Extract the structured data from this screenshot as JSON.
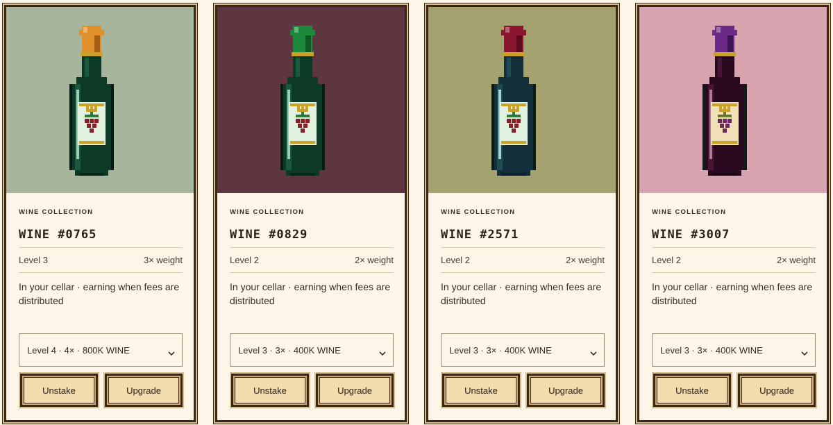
{
  "cards": [
    {
      "collection": "WINE COLLECTION",
      "name": "WINE #0765",
      "level": "Level 3",
      "weight": "3× weight",
      "status": "In your cellar · earning when fees are distributed",
      "upgrade_option": "Level 4 · 4× · 800K WINE",
      "unstake_label": "Unstake",
      "upgrade_label": "Upgrade",
      "art": {
        "bg": "#a6b59c",
        "cap": "#e0902a",
        "cap_dark": "#a35f14",
        "glass": "#0d3a26",
        "glass_mid": "#1a5a3a",
        "glass_hi": "#9ad0b4",
        "label": "#e2f2e0",
        "grape": "#8a1e26",
        "leaf": "#2e7a36"
      }
    },
    {
      "collection": "WINE COLLECTION",
      "name": "WINE #0829",
      "level": "Level 2",
      "weight": "2× weight",
      "status": "In your cellar · earning when fees are distributed",
      "upgrade_option": "Level 3 · 3× · 400K WINE",
      "unstake_label": "Unstake",
      "upgrade_label": "Upgrade",
      "art": {
        "bg": "#5e3640",
        "cap": "#1c8a3a",
        "cap_dark": "#0f5a24",
        "glass": "#0d3a26",
        "glass_mid": "#1a5a3a",
        "glass_hi": "#9ad0b4",
        "label": "#e2f2e0",
        "grape": "#8a1e26",
        "leaf": "#2e7a36"
      }
    },
    {
      "collection": "WINE COLLECTION",
      "name": "WINE #2571",
      "level": "Level 2",
      "weight": "2× weight",
      "status": "In your cellar · earning when fees are distributed",
      "upgrade_option": "Level 3 · 3× · 400K WINE",
      "unstake_label": "Unstake",
      "upgrade_label": "Upgrade",
      "art": {
        "bg": "#a4a26e",
        "cap": "#8a1630",
        "cap_dark": "#5a0c1e",
        "glass": "#13303a",
        "glass_mid": "#1e4a56",
        "glass_hi": "#a8d4dc",
        "label": "#e2f2e0",
        "grape": "#8a1e26",
        "leaf": "#2e7a36"
      }
    },
    {
      "collection": "WINE COLLECTION",
      "name": "WINE #3007",
      "level": "Level 2",
      "weight": "2× weight",
      "status": "In your cellar · earning when fees are distributed",
      "upgrade_option": "Level 3 · 3× · 400K WINE",
      "unstake_label": "Unstake",
      "upgrade_label": "Upgrade",
      "art": {
        "bg": "#d8a4b0",
        "cap": "#6a2a86",
        "cap_dark": "#3e1456",
        "glass": "#2a0a1e",
        "glass_mid": "#4a1434",
        "glass_hi": "#b07a9a",
        "label": "#efe0b8",
        "grape": "#6a2a5a",
        "leaf": "#6a7a2a"
      }
    }
  ]
}
